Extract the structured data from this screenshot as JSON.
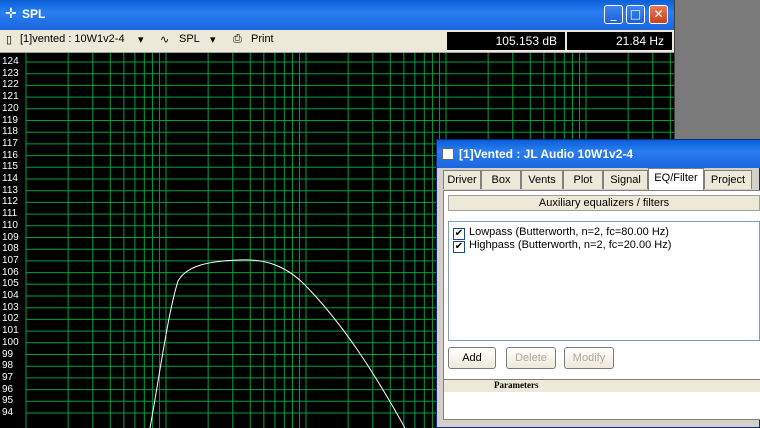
{
  "spl_window": {
    "title": "SPL",
    "title_icon": "plus-cross-icon",
    "toolbar": {
      "driver_select": "[1]vented : 10W1v2-4",
      "plot_mode_select": "SPL",
      "print_label": "Print",
      "readout_db": "105.153 dB",
      "readout_hz": "21.84 Hz"
    },
    "plot": {
      "y_ticks": [
        "124",
        "123",
        "122",
        "121",
        "120",
        "119",
        "118",
        "117",
        "116",
        "115",
        "114",
        "113",
        "112",
        "111",
        "110",
        "109",
        "108",
        "107",
        "106",
        "105",
        "104",
        "103",
        "102",
        "101",
        "100",
        "99",
        "98",
        "97",
        "96",
        "95",
        "94"
      ],
      "grid_color": "#00a040",
      "curve_color": "#ffffff"
    }
  },
  "dialog": {
    "title": "[1]Vented : JL Audio 10W1v2-4",
    "tabs": [
      "Driver",
      "Box",
      "Vents",
      "Plot",
      "Signal",
      "EQ/Filter",
      "Project"
    ],
    "active_tab": "EQ/Filter",
    "section_header": "Auxiliary equalizers / filters",
    "filters": [
      {
        "label": "Lowpass (Butterworth, n=2, fc=80.00 Hz)",
        "checked": "✔"
      },
      {
        "label": "Highpass (Butterworth, n=2, fc=20.00 Hz)",
        "checked": "✔"
      }
    ],
    "buttons": {
      "add": "Add",
      "delete": "Delete",
      "modify": "Modify"
    },
    "params_label": "Parameters"
  }
}
